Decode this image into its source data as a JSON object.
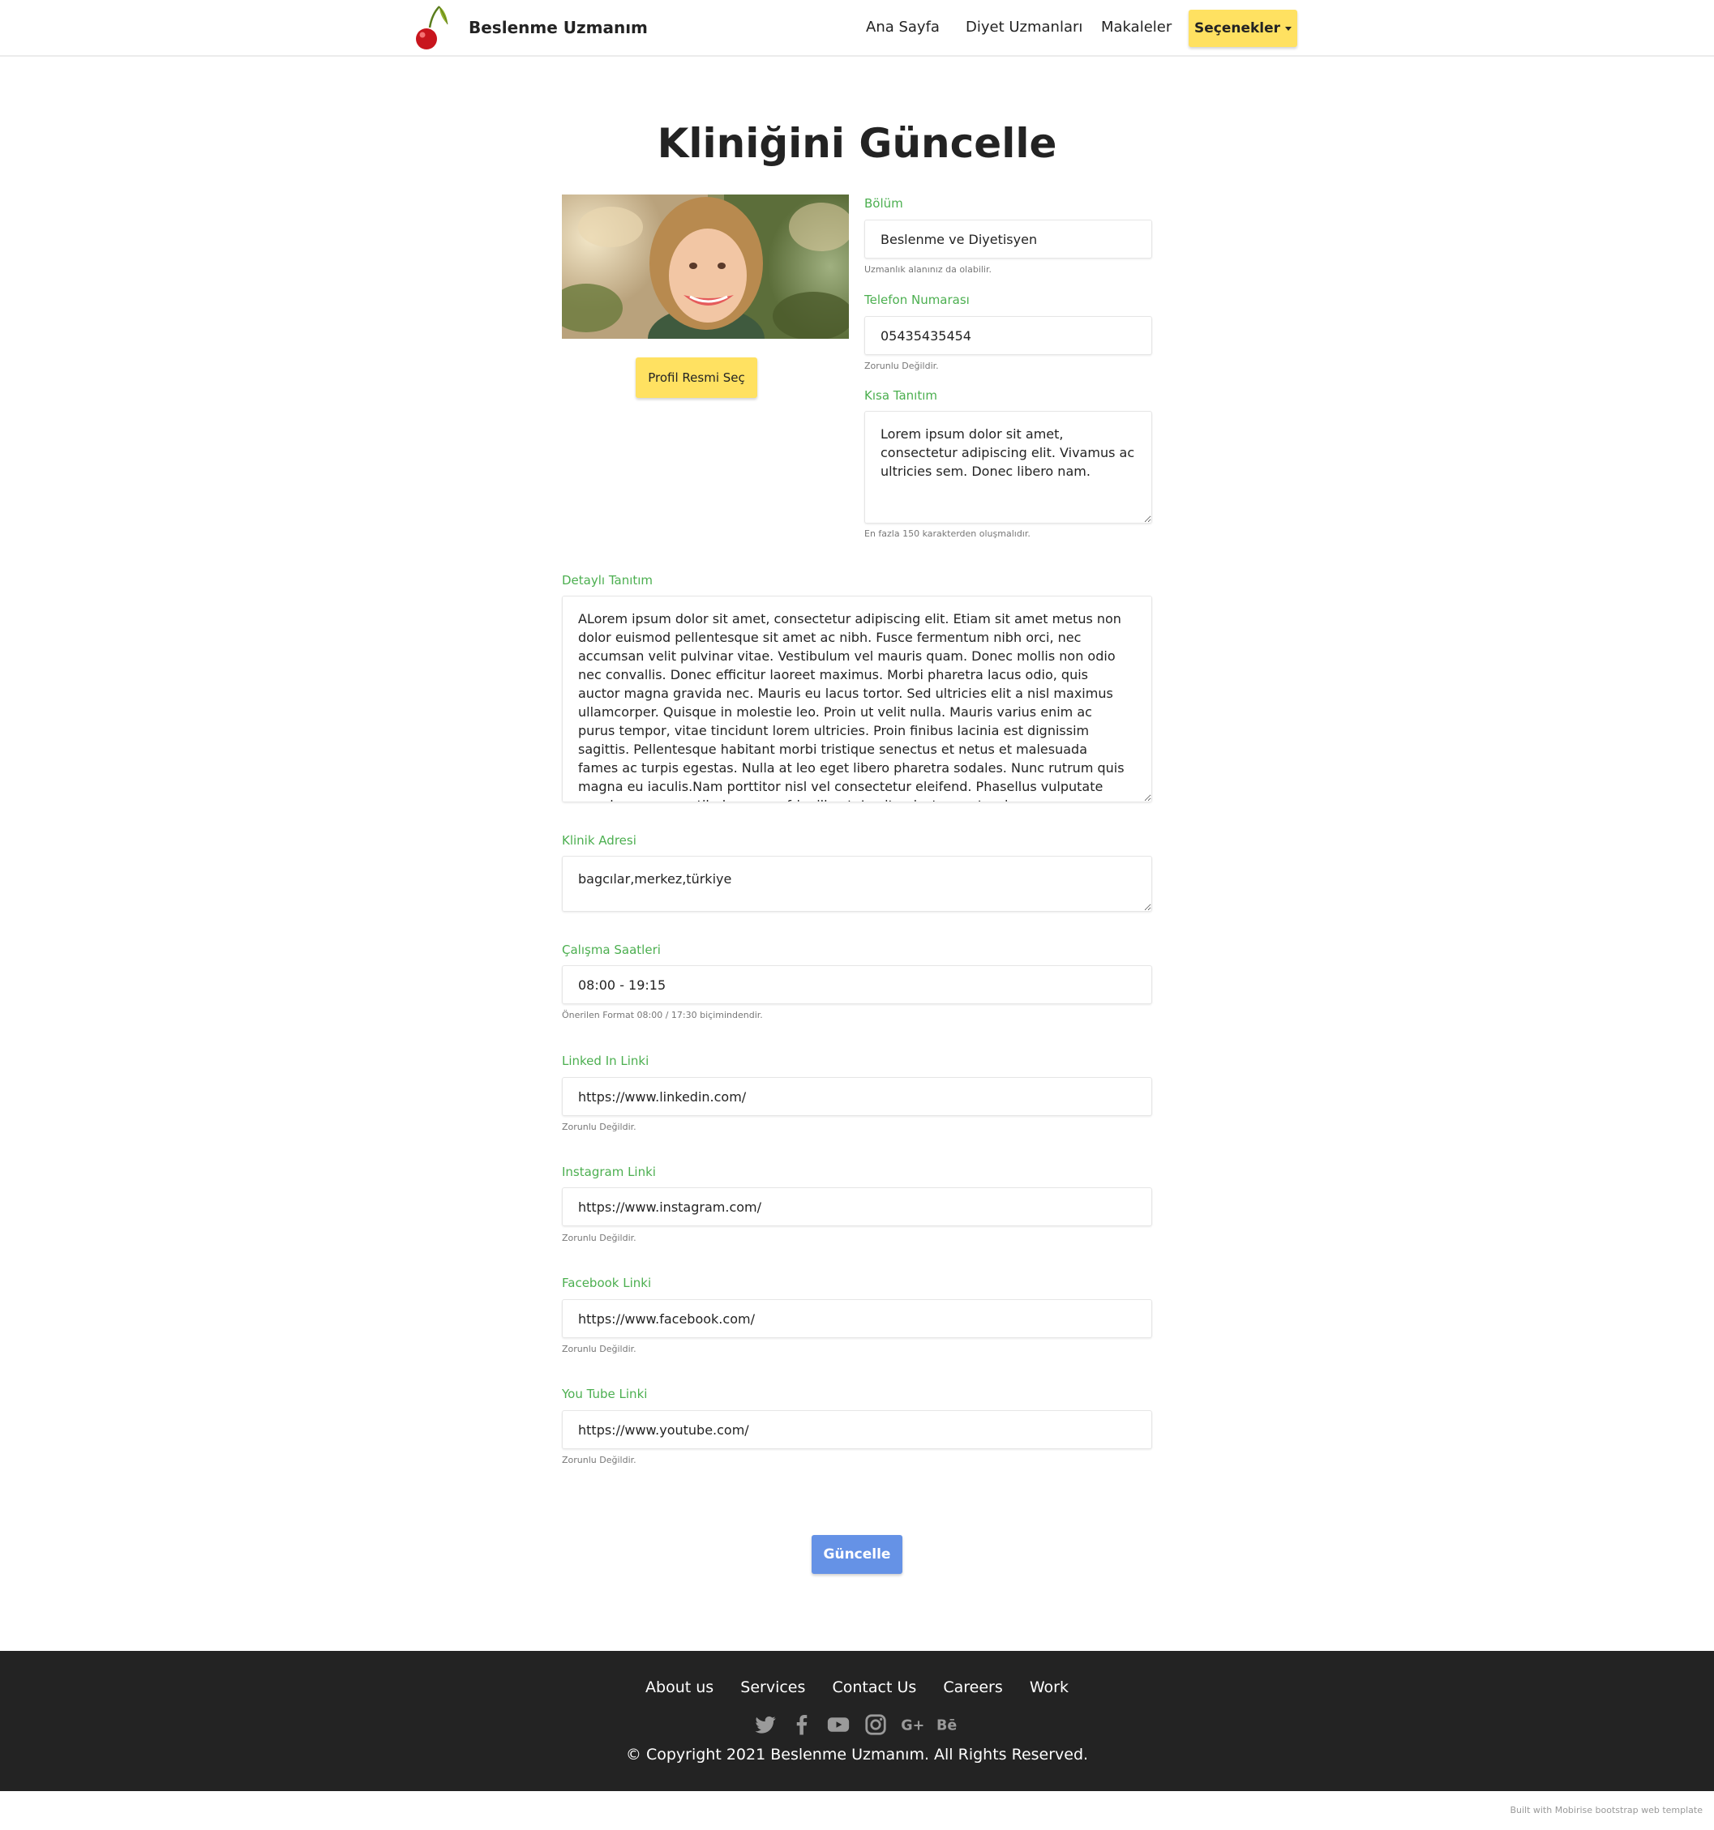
{
  "navbar": {
    "brand": "Beslenme Uzmanım",
    "links": [
      "Ana Sayfa",
      "Diyet Uzmanları",
      "Makaleler"
    ],
    "dropdown_label": "Seçenekler"
  },
  "page": {
    "title": "Kliniğini Güncelle"
  },
  "profile": {
    "select_photo_button": "Profil Resmi Seç"
  },
  "form": {
    "bolum": {
      "label": "Bölüm",
      "value": "Beslenme ve Diyetisyen",
      "hint": "Uzmanlık alanınız da olabilir."
    },
    "telefon": {
      "label": "Telefon Numarası",
      "value": "05435435454",
      "hint": "Zorunlu Değildir."
    },
    "kisa_tanitim": {
      "label": "Kısa Tanıtım",
      "value": "Lorem ipsum dolor sit amet, consectetur adipiscing elit. Vivamus ac ultricies sem. Donec libero nam.",
      "hint": "En fazla 150 karakterden oluşmalıdır."
    },
    "detayli_tanitim": {
      "label": "Detaylı Tanıtım",
      "value": "ALorem ipsum dolor sit amet, consectetur adipiscing elit. Etiam sit amet metus non dolor euismod pellentesque sit amet ac nibh. Fusce fermentum nibh orci, nec accumsan velit pulvinar vitae. Vestibulum vel mauris quam. Donec mollis non odio nec convallis. Donec efficitur laoreet maximus. Morbi pharetra lacus odio, quis auctor magna gravida nec. Mauris eu lacus tortor. Sed ultricies elit a nisl maximus ullamcorper. Quisque in molestie leo. Proin ut velit nulla. Mauris varius enim ac purus tempor, vitae tincidunt lorem ultricies. Proin finibus lacinia est dignissim sagittis. Pellentesque habitant morbi tristique senectus et netus et malesuada fames ac turpis egestas. Nulla at leo eget libero pharetra sodales. Nunc rutrum quis magna eu iaculis.Nam porttitor nisl vel consectetur eleifend. Phasellus vulputate eros lorem, ac vestibulum nunc fringilla et. In vitae justo non turpis"
    },
    "klinik_adresi": {
      "label": "Klinik Adresi",
      "value": "bagcılar,merkez,türkiye"
    },
    "calisma_saatleri": {
      "label": "Çalışma Saatleri",
      "value": "08:00 - 19:15",
      "hint": "Önerilen Format 08:00 / 17:30 biçimindendir."
    },
    "linkedin": {
      "label": "Linked In Linki",
      "value": "https://www.linkedin.com/",
      "hint": "Zorunlu Değildir."
    },
    "instagram": {
      "label": "Instagram Linki",
      "value": "https://www.instagram.com/",
      "hint": "Zorunlu Değildir."
    },
    "facebook": {
      "label": "Facebook Linki",
      "value": "https://www.facebook.com/",
      "hint": "Zorunlu Değildir."
    },
    "youtube": {
      "label": "You Tube Linki",
      "value": "https://www.youtube.com/",
      "hint": "Zorunlu Değildir."
    },
    "submit_label": "Güncelle"
  },
  "footer": {
    "links": [
      "About us",
      "Services",
      "Contact Us",
      "Careers",
      "Work"
    ],
    "social_icons": [
      "twitter-icon",
      "facebook-icon",
      "youtube-icon",
      "instagram-icon",
      "google-plus-icon",
      "behance-icon"
    ],
    "copyright": "© Copyright 2021 Beslenme Uzmanım. All Rights Reserved."
  },
  "built_with": "Built with Mobirise bootstrap web template",
  "colors": {
    "accent_yellow": "#ffe161",
    "label_green": "#4caf50",
    "submit_blue": "#6592e6",
    "footer_bg": "#232323"
  }
}
